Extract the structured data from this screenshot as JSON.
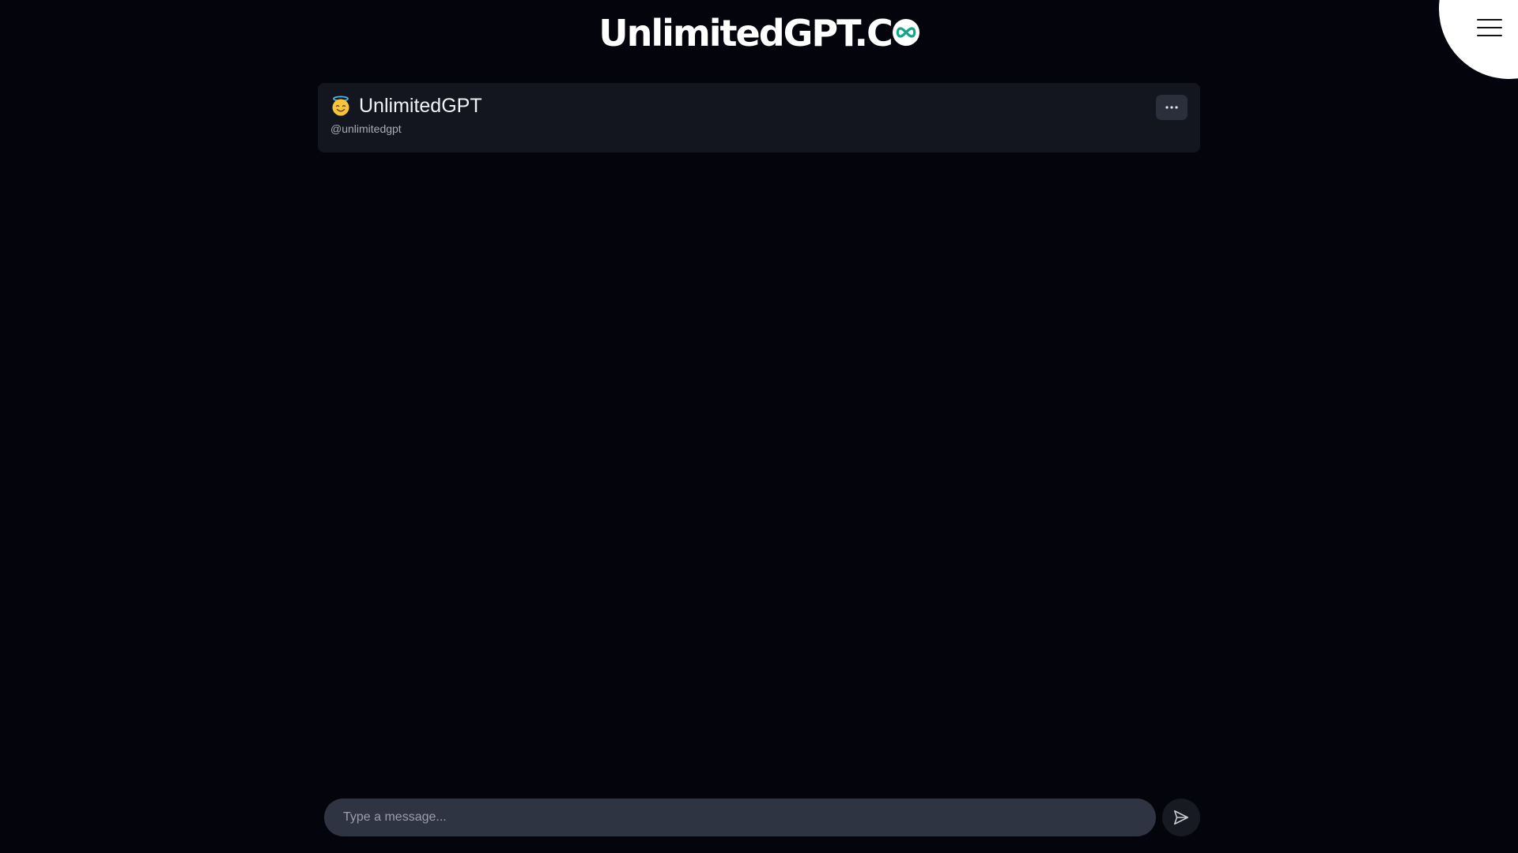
{
  "header": {
    "logo_text": "UnlimitedGPT.C",
    "logo_icon": "infinity-icon",
    "menu_icon": "hamburger-icon"
  },
  "chat": {
    "bot_emoji": "smiling-face-with-halo-icon",
    "bot_name": "UnlimitedGPT",
    "bot_handle": "@unlimitedgpt",
    "more_icon": "ellipsis-icon"
  },
  "composer": {
    "placeholder": "Type a message...",
    "value": "",
    "send_icon": "send-icon"
  },
  "colors": {
    "background": "#03040c",
    "card": "#14161f",
    "input": "#2f3442",
    "accent": "#12a58a",
    "corner": "#ffffff"
  }
}
